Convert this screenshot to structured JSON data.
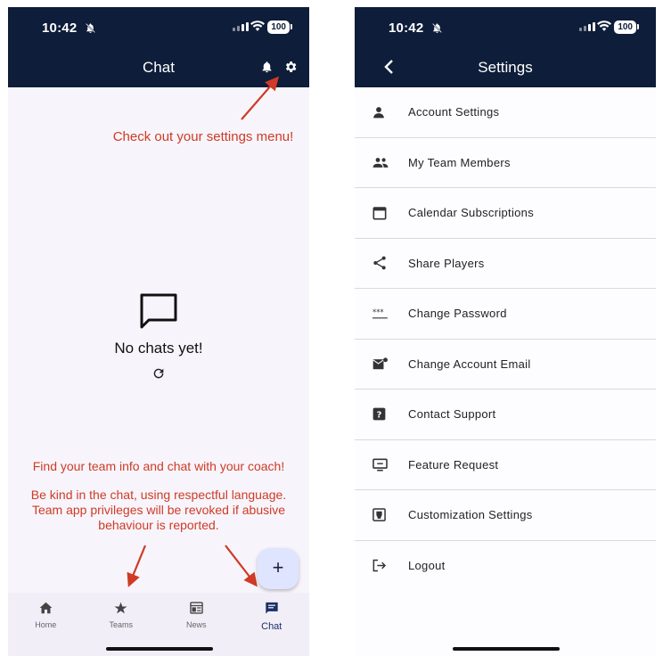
{
  "left": {
    "status": {
      "time": "10:42",
      "battery": "100"
    },
    "header": {
      "title": "Chat"
    },
    "empty_state": {
      "message": "No chats yet!"
    },
    "annotations": {
      "settings_hint": "Check out your settings menu!",
      "team_hint": "Find your team info and chat with your coach!",
      "conduct_line1": "Be kind in the chat, using respectful language.",
      "conduct_line2": "Team app privileges will be revoked if abusive",
      "conduct_line3": "behaviour is reported."
    },
    "fab_label": "+",
    "nav": [
      {
        "label": "Home",
        "icon": "home-icon"
      },
      {
        "label": "Teams",
        "icon": "star-icon"
      },
      {
        "label": "News",
        "icon": "newspaper-icon"
      },
      {
        "label": "Chat",
        "icon": "chat-icon",
        "active": true
      }
    ],
    "colors": {
      "header_bg": "#0e1d3a",
      "annotation": "#d03a26",
      "accent": "#1b2f66"
    }
  },
  "right": {
    "status": {
      "time": "10:42",
      "battery": "100"
    },
    "header": {
      "title": "Settings"
    },
    "items": [
      {
        "label": "Account Settings",
        "icon": "person-icon"
      },
      {
        "label": "My Team Members",
        "icon": "group-icon"
      },
      {
        "label": "Calendar Subscriptions",
        "icon": "calendar-icon"
      },
      {
        "label": "Share Players",
        "icon": "share-icon"
      },
      {
        "label": "Change Password",
        "icon": "password-icon"
      },
      {
        "label": "Change Account Email",
        "icon": "email-icon"
      },
      {
        "label": "Contact Support",
        "icon": "help-icon"
      },
      {
        "label": "Feature Request",
        "icon": "feature-request-icon"
      },
      {
        "label": "Customization Settings",
        "icon": "customization-icon"
      },
      {
        "label": "Logout",
        "icon": "logout-icon"
      }
    ]
  }
}
